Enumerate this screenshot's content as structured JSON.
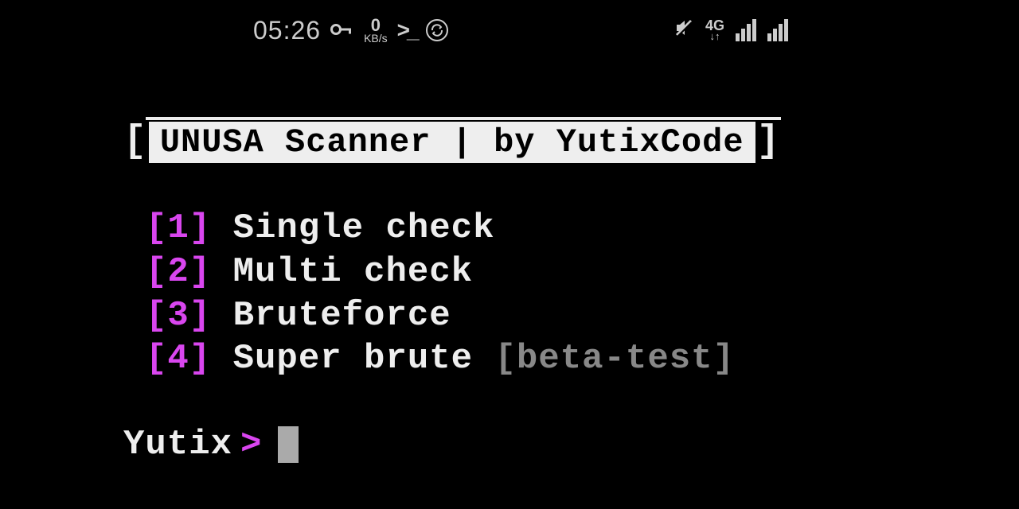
{
  "status": {
    "time": "05:26",
    "net_speed_val": "0",
    "net_speed_unit": "KB/s",
    "net_type": "4G",
    "net_arrows": "↓↑"
  },
  "banner": {
    "text": "UNUSA Scanner | by YutixCode"
  },
  "menu": [
    {
      "num": "[1]",
      "label": " Single check",
      "tag": ""
    },
    {
      "num": "[2]",
      "label": " Multi check",
      "tag": ""
    },
    {
      "num": "[3]",
      "label": " Bruteforce",
      "tag": ""
    },
    {
      "num": "[4]",
      "label": " Super brute ",
      "tag": "[beta-test]"
    }
  ],
  "prompt": {
    "label": "Yutix ",
    "symbol": ">"
  }
}
